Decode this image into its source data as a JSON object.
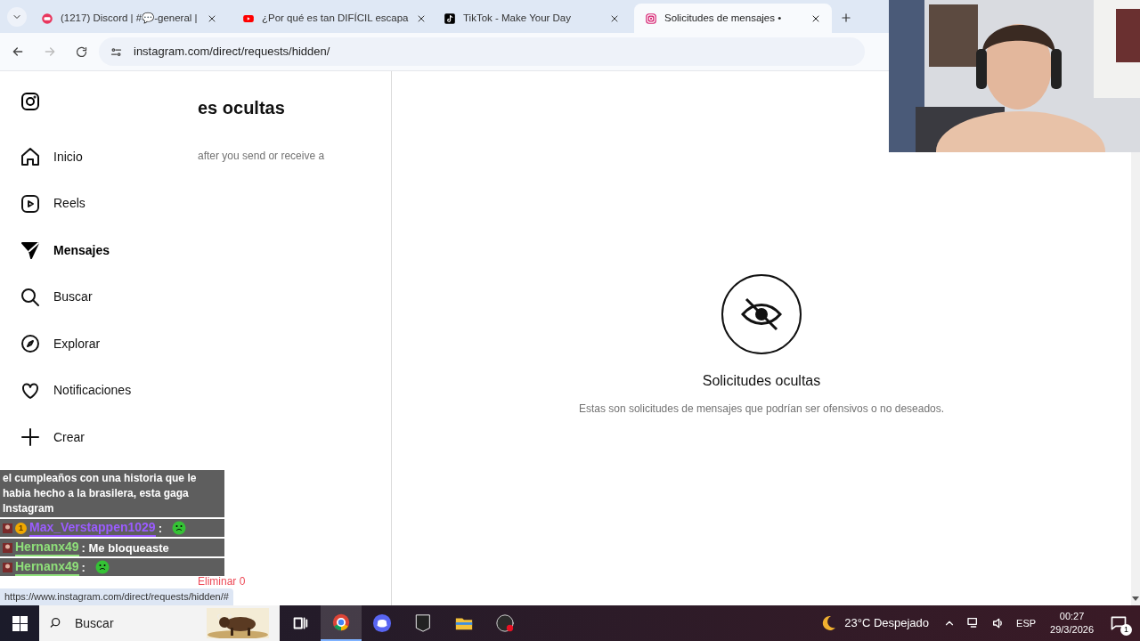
{
  "browser": {
    "tabs": [
      {
        "title": "(1217) Discord | #💬-general |",
        "selected": false
      },
      {
        "title": "¿Por qué es tan DIFÍCIL escapa",
        "selected": false
      },
      {
        "title": "TikTok - Make Your Day",
        "selected": false
      },
      {
        "title": "Solicitudes de mensajes •",
        "selected": true
      }
    ],
    "address": "instagram.com/direct/requests/hidden/"
  },
  "sidebar": {
    "items": [
      {
        "label": "Inicio",
        "selected": false
      },
      {
        "label": "Reels",
        "selected": false
      },
      {
        "label": "Mensajes",
        "selected": true
      },
      {
        "label": "Buscar",
        "selected": false
      },
      {
        "label": "Explorar",
        "selected": false
      },
      {
        "label": "Notificaciones",
        "selected": false
      },
      {
        "label": "Crear",
        "selected": false
      }
    ]
  },
  "panel": {
    "title": "es ocultas",
    "subtitle": "after you send or receive a",
    "footer": "Eliminar 0"
  },
  "main": {
    "heading": "Solicitudes ocultas",
    "description": "Estas son solicitudes de mensajes que podrían ser ofensivos o no deseados."
  },
  "chat": [
    {
      "kind": "text",
      "text": "el cumpleaños con una historia que le habia hecho a la brasilera, esta gaga Instagram"
    },
    {
      "kind": "message",
      "user": "Max_Verstappen1029",
      "color": "#9b5cff",
      "badge": "1",
      "text": ":",
      "emote": true
    },
    {
      "kind": "message",
      "user": "Hernanx49",
      "color": "#8fe07a",
      "text": ": Me bloqueaste",
      "emote": false
    },
    {
      "kind": "message",
      "user": "Hernanx49",
      "color": "#8fe07a",
      "text": ":",
      "emote": true
    }
  ],
  "status_url": "https://www.instagram.com/direct/requests/hidden/#",
  "taskbar": {
    "search": "Buscar",
    "apps": [
      {
        "selected": false
      },
      {
        "selected": true
      },
      {
        "selected": false
      },
      {
        "selected": false
      },
      {
        "selected": false
      },
      {
        "selected": false
      }
    ],
    "weather": "23°C Despejado",
    "language": "ESP",
    "time": "00:27",
    "date": "29/3/2026",
    "notifications": "1"
  }
}
